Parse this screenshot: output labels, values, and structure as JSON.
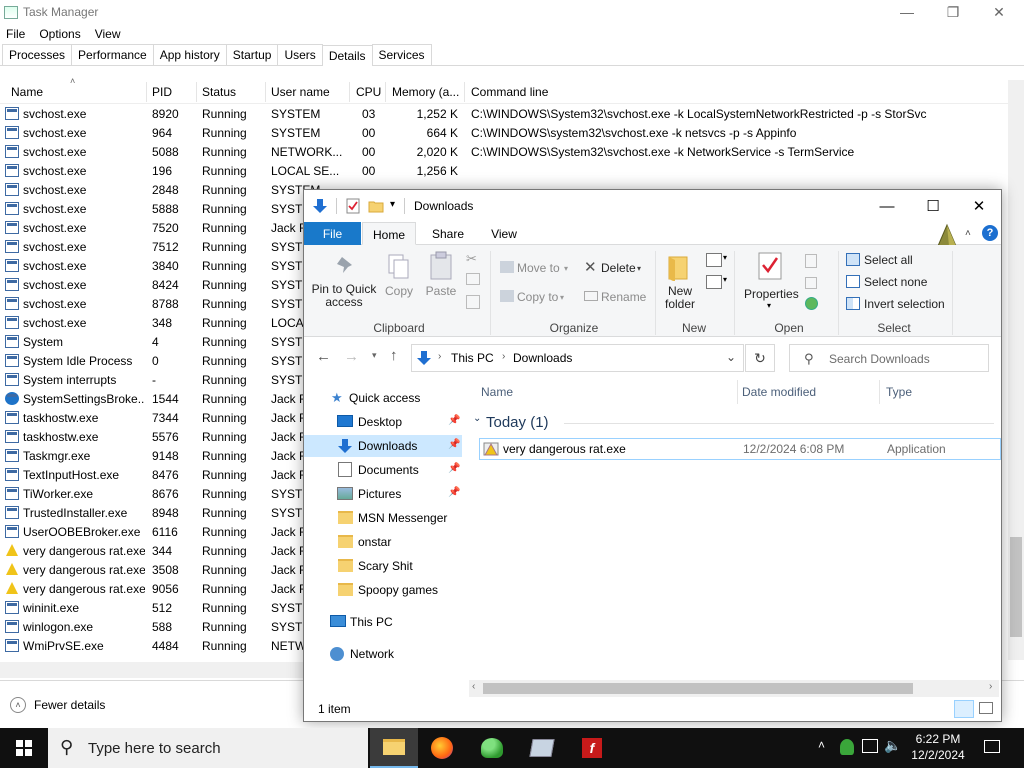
{
  "task_manager": {
    "title": "Task Manager",
    "menu": [
      "File",
      "Options",
      "View"
    ],
    "tabs": [
      "Processes",
      "Performance",
      "App history",
      "Startup",
      "Users",
      "Details",
      "Services"
    ],
    "active_tab": "Details",
    "columns": [
      "Name",
      "PID",
      "Status",
      "User name",
      "CPU",
      "Memory (a...",
      "Command line"
    ],
    "rows": [
      {
        "name": "svchost.exe",
        "pid": "8920",
        "status": "Running",
        "user": "SYSTEM",
        "cpu": "03",
        "mem": "1,252 K",
        "cmd": "C:\\WINDOWS\\System32\\svchost.exe -k LocalSystemNetworkRestricted -p -s StorSvc",
        "icon": "window"
      },
      {
        "name": "svchost.exe",
        "pid": "964",
        "status": "Running",
        "user": "SYSTEM",
        "cpu": "00",
        "mem": "664 K",
        "cmd": "C:\\WINDOWS\\system32\\svchost.exe -k netsvcs -p -s Appinfo",
        "icon": "window"
      },
      {
        "name": "svchost.exe",
        "pid": "5088",
        "status": "Running",
        "user": "NETWORK...",
        "cpu": "00",
        "mem": "2,020 K",
        "cmd": "C:\\WINDOWS\\System32\\svchost.exe -k NetworkService -s TermService",
        "icon": "window"
      },
      {
        "name": "svchost.exe",
        "pid": "196",
        "status": "Running",
        "user": "LOCAL SE...",
        "cpu": "00",
        "mem": "1,256 K",
        "cmd": "",
        "icon": "window"
      },
      {
        "name": "svchost.exe",
        "pid": "2848",
        "status": "Running",
        "user": "SYSTEM",
        "cpu": "",
        "mem": "",
        "cmd": "",
        "icon": "window"
      },
      {
        "name": "svchost.exe",
        "pid": "5888",
        "status": "Running",
        "user": "SYSTE",
        "cpu": "",
        "mem": "",
        "cmd": "",
        "icon": "window"
      },
      {
        "name": "svchost.exe",
        "pid": "7520",
        "status": "Running",
        "user": "Jack F",
        "cpu": "",
        "mem": "",
        "cmd": "",
        "icon": "window"
      },
      {
        "name": "svchost.exe",
        "pid": "7512",
        "status": "Running",
        "user": "SYSTE",
        "cpu": "",
        "mem": "",
        "cmd": "",
        "icon": "window"
      },
      {
        "name": "svchost.exe",
        "pid": "3840",
        "status": "Running",
        "user": "SYSTE",
        "cpu": "",
        "mem": "",
        "cmd": "",
        "icon": "window"
      },
      {
        "name": "svchost.exe",
        "pid": "8424",
        "status": "Running",
        "user": "SYSTE",
        "cpu": "",
        "mem": "",
        "cmd": "",
        "icon": "window"
      },
      {
        "name": "svchost.exe",
        "pid": "8788",
        "status": "Running",
        "user": "SYSTE",
        "cpu": "",
        "mem": "",
        "cmd": "",
        "icon": "window"
      },
      {
        "name": "svchost.exe",
        "pid": "348",
        "status": "Running",
        "user": "LOCA",
        "cpu": "",
        "mem": "",
        "cmd": "",
        "icon": "window"
      },
      {
        "name": "System",
        "pid": "4",
        "status": "Running",
        "user": "SYSTE",
        "cpu": "",
        "mem": "",
        "cmd": "",
        "icon": "window"
      },
      {
        "name": "System Idle Process",
        "pid": "0",
        "status": "Running",
        "user": "SYSTE",
        "cpu": "",
        "mem": "",
        "cmd": "",
        "icon": "window"
      },
      {
        "name": "System interrupts",
        "pid": "-",
        "status": "Running",
        "user": "SYSTE",
        "cpu": "",
        "mem": "",
        "cmd": "",
        "icon": "window"
      },
      {
        "name": "SystemSettingsBroke...",
        "pid": "1544",
        "status": "Running",
        "user": "Jack F",
        "cpu": "",
        "mem": "",
        "cmd": "",
        "icon": "gear"
      },
      {
        "name": "taskhostw.exe",
        "pid": "7344",
        "status": "Running",
        "user": "Jack F",
        "cpu": "",
        "mem": "",
        "cmd": "",
        "icon": "window"
      },
      {
        "name": "taskhostw.exe",
        "pid": "5576",
        "status": "Running",
        "user": "Jack F",
        "cpu": "",
        "mem": "",
        "cmd": "",
        "icon": "window"
      },
      {
        "name": "Taskmgr.exe",
        "pid": "9148",
        "status": "Running",
        "user": "Jack F",
        "cpu": "",
        "mem": "",
        "cmd": "",
        "icon": "window"
      },
      {
        "name": "TextInputHost.exe",
        "pid": "8476",
        "status": "Running",
        "user": "Jack F",
        "cpu": "",
        "mem": "",
        "cmd": "",
        "icon": "window"
      },
      {
        "name": "TiWorker.exe",
        "pid": "8676",
        "status": "Running",
        "user": "SYSTE",
        "cpu": "",
        "mem": "",
        "cmd": "",
        "icon": "window"
      },
      {
        "name": "TrustedInstaller.exe",
        "pid": "8948",
        "status": "Running",
        "user": "SYSTE",
        "cpu": "",
        "mem": "",
        "cmd": "",
        "icon": "window"
      },
      {
        "name": "UserOOBEBroker.exe",
        "pid": "6116",
        "status": "Running",
        "user": "Jack F",
        "cpu": "",
        "mem": "",
        "cmd": "",
        "icon": "window"
      },
      {
        "name": "very dangerous rat.exe",
        "pid": "344",
        "status": "Running",
        "user": "Jack F",
        "cpu": "",
        "mem": "",
        "cmd": "",
        "icon": "warn"
      },
      {
        "name": "very dangerous rat.exe",
        "pid": "3508",
        "status": "Running",
        "user": "Jack F",
        "cpu": "",
        "mem": "",
        "cmd": "",
        "icon": "warn"
      },
      {
        "name": "very dangerous rat.exe",
        "pid": "9056",
        "status": "Running",
        "user": "Jack F",
        "cpu": "",
        "mem": "",
        "cmd": "",
        "icon": "warn"
      },
      {
        "name": "wininit.exe",
        "pid": "512",
        "status": "Running",
        "user": "SYSTE",
        "cpu": "",
        "mem": "",
        "cmd": "",
        "icon": "window"
      },
      {
        "name": "winlogon.exe",
        "pid": "588",
        "status": "Running",
        "user": "SYSTE",
        "cpu": "",
        "mem": "",
        "cmd": "",
        "icon": "window"
      },
      {
        "name": "WmiPrvSE.exe",
        "pid": "4484",
        "status": "Running",
        "user": "NETW",
        "cpu": "",
        "mem": "",
        "cmd": "",
        "icon": "window"
      }
    ],
    "fewer_details": "Fewer details"
  },
  "explorer": {
    "title": "Downloads",
    "ribbon_tabs": [
      "File",
      "Home",
      "Share",
      "View"
    ],
    "clipboard": {
      "pin": "Pin to Quick access",
      "copy": "Copy",
      "paste": "Paste",
      "label": "Clipboard"
    },
    "organize": {
      "move_to": "Move to",
      "copy_to": "Copy to",
      "delete": "Delete",
      "rename": "Rename",
      "label": "Organize"
    },
    "new": {
      "new_folder": "New folder",
      "label": "New"
    },
    "open": {
      "properties": "Properties",
      "label": "Open"
    },
    "select": {
      "all": "Select all",
      "none": "Select none",
      "invert": "Invert selection",
      "label": "Select"
    },
    "breadcrumb": [
      "This PC",
      "Downloads"
    ],
    "search_placeholder": "Search Downloads",
    "nav": {
      "quick_access": "Quick access",
      "items": [
        "Desktop",
        "Downloads",
        "Documents",
        "Pictures",
        "MSN Messenger",
        "onstar",
        "Scary Shit",
        "Spoopy games"
      ],
      "this_pc": "This PC",
      "network": "Network"
    },
    "columns": [
      "Name",
      "Date modified",
      "Type"
    ],
    "group": "Today (1)",
    "file": {
      "name": "very dangerous rat.exe",
      "date": "12/2/2024 6:08 PM",
      "type": "Application"
    },
    "status": "1 item"
  },
  "taskbar": {
    "search_placeholder": "Type here to search",
    "time": "6:22 PM",
    "date": "12/2/2024"
  }
}
